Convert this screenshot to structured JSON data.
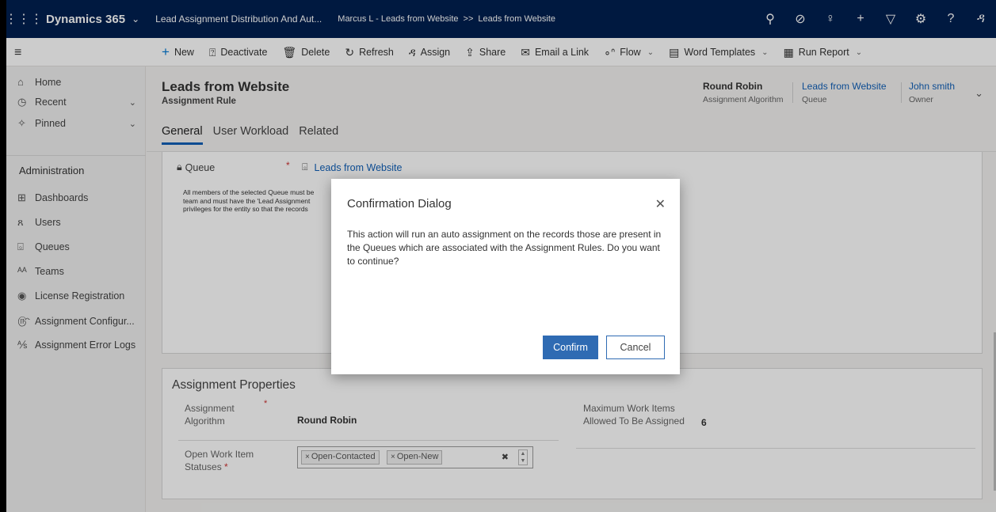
{
  "topbar": {
    "brand": "Dynamics 365",
    "app_name": "Lead Assignment Distribution And Aut...",
    "breadcrumb": [
      "Marcus L - Leads from Website",
      "Leads from Website"
    ],
    "breadcrumb_sep": ">>",
    "icons": [
      "search-icon",
      "task-icon",
      "lightbulb-icon",
      "plus-icon",
      "filter-icon",
      "settings-icon",
      "help-icon",
      "user-icon"
    ]
  },
  "commands": {
    "new": "New",
    "deactivate": "Deactivate",
    "delete": "Delete",
    "refresh": "Refresh",
    "assign": "Assign",
    "share": "Share",
    "email_link": "Email a Link",
    "flow": "Flow",
    "word_templates": "Word Templates",
    "run_report": "Run Report"
  },
  "sidebar": {
    "items": [
      {
        "label": "Home"
      },
      {
        "label": "Recent"
      },
      {
        "label": "Pinned"
      }
    ],
    "section_title": "Administration",
    "admin_items": [
      {
        "label": "Dashboards"
      },
      {
        "label": "Users"
      },
      {
        "label": "Queues"
      },
      {
        "label": "Teams"
      },
      {
        "label": "License Registration"
      },
      {
        "label": "Assignment Configur..."
      },
      {
        "label": "Assignment Error Logs"
      }
    ]
  },
  "header": {
    "title": "Leads from Website",
    "subtitle": "Assignment Rule",
    "fields": [
      {
        "value": "Round Robin",
        "label": "Assignment Algorithm"
      },
      {
        "value": "Leads from Website",
        "label": "Queue"
      },
      {
        "value": "John smith",
        "label": "Owner"
      }
    ],
    "tabs": [
      "General",
      "User Workload",
      "Related"
    ]
  },
  "form": {
    "queue_label": "Queue",
    "queue_required": "*",
    "queue_value": "Leads from Website",
    "queue_note": [
      "All members of the selected Queue must be",
      "team and must have the 'Lead Assignment",
      "privileges for the entity so that the records"
    ],
    "section_title": "Assignment Properties",
    "algorithm_label": "Assignment Algorithm",
    "algorithm_value": "Round Robin",
    "max_items_label": "Maximum Work Items Allowed To Be Assigned",
    "max_items_value": "6",
    "statuses_label": "Open Work Item Statuses",
    "statuses": [
      "Open-Contacted",
      "Open-New"
    ]
  },
  "dialog": {
    "title": "Confirmation Dialog",
    "message": "This action will run an auto assignment on the records those are present in the Queues which are associated with the Assignment Rules. Do you want to continue?",
    "confirm": "Confirm",
    "cancel": "Cancel"
  },
  "colors": {
    "topbar": "#002050",
    "link": "#1160b7",
    "primary_button": "#2f6bb3"
  }
}
